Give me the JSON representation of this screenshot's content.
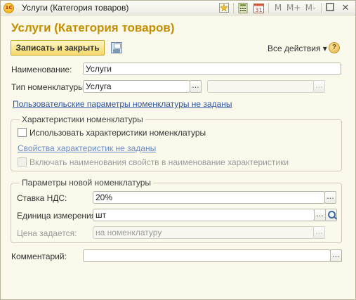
{
  "window": {
    "app_icon_text": "1С",
    "title": "Услуги (Категория товаров)",
    "toolbar": {
      "favorite_icon": "star-icon",
      "calculator_icon": "calculator-icon",
      "calendar_label": "31",
      "m_label": "M",
      "m_plus_label": "M+",
      "m_minus_label": "M-",
      "maximize_icon": "square-icon",
      "close_label": "✕"
    }
  },
  "form": {
    "title": "Услуги (Категория товаров)",
    "save_close_label": "Записать и закрыть",
    "all_actions_label": "Все действия ▾",
    "help_label": "?"
  },
  "fields": {
    "name_label": "Наименование:",
    "name_value": "Услуги",
    "type_label": "Тип номенклатуры:",
    "type_value": "Услуга",
    "type_extra_value": "",
    "custom_params_link": "Пользовательские параметры номенклатуры не заданы"
  },
  "characteristics": {
    "group_title": "Характеристики номенклатуры",
    "use_label": "Использовать характеристики номенклатуры",
    "use_checked": false,
    "properties_link": "Свойства характеристик не заданы",
    "include_names_label": "Включать наименования свойств в наименование характеристики",
    "include_names_checked": false
  },
  "new_item_params": {
    "group_title": "Параметры новой номенклатуры",
    "vat_label": "Ставка НДС:",
    "vat_value": "20%",
    "unit_label": "Единица измерения:",
    "unit_value": "шт",
    "price_label": "Цена задается:",
    "price_value": "на номенклатуру"
  },
  "comment": {
    "label": "Комментарий:",
    "value": ""
  },
  "colors": {
    "accent": "#c38f00",
    "background": "#fbf9ec",
    "link": "#2f55a0"
  }
}
